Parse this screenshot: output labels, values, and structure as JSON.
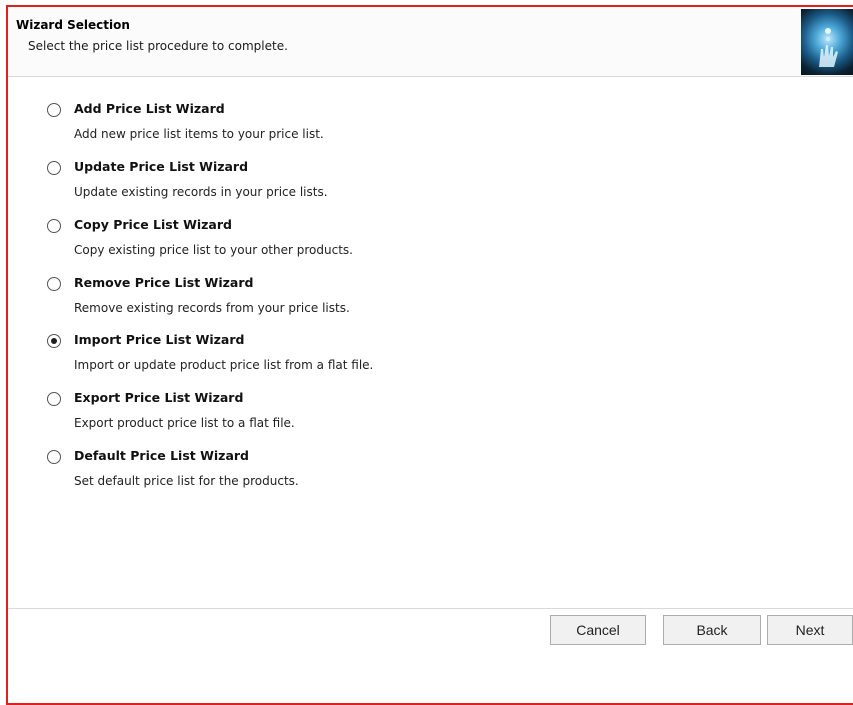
{
  "header": {
    "title": "Wizard Selection",
    "subtitle": "Select the price list procedure to complete."
  },
  "options": [
    {
      "title": "Add Price List Wizard",
      "description": "Add new price list items to your price list.",
      "selected": false
    },
    {
      "title": "Update Price List Wizard",
      "description": "Update existing records in your price lists.",
      "selected": false
    },
    {
      "title": "Copy Price List Wizard",
      "description": "Copy existing price list to your other products.",
      "selected": false
    },
    {
      "title": "Remove Price List Wizard",
      "description": "Remove existing records from your price lists.",
      "selected": false
    },
    {
      "title": "Import Price List Wizard",
      "description": "Import or update product price list from a flat file.",
      "selected": true
    },
    {
      "title": "Export Price List Wizard",
      "description": "Export product price list to a flat file.",
      "selected": false
    },
    {
      "title": "Default Price List Wizard",
      "description": "Set default price list for the products.",
      "selected": false
    }
  ],
  "buttons": {
    "cancel": "Cancel",
    "back": "Back",
    "next": "Next"
  },
  "colors": {
    "frame_border": "#e0201b"
  }
}
